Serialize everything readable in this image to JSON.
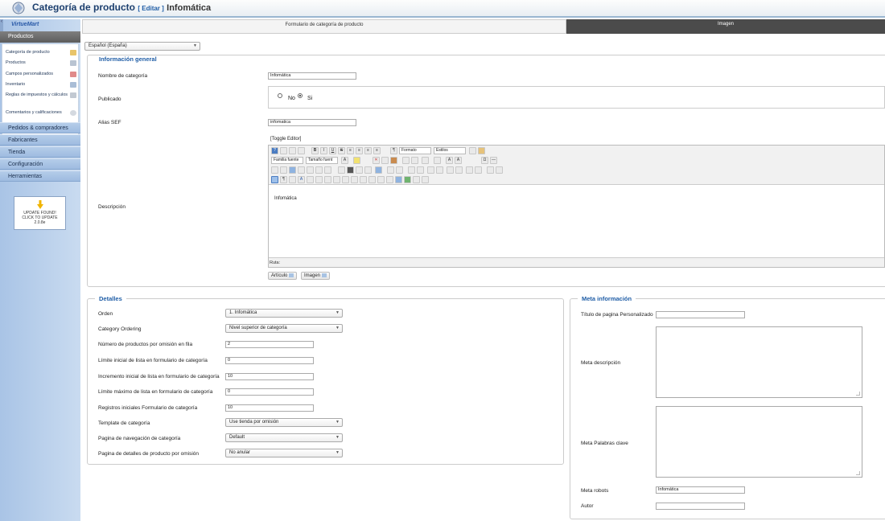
{
  "header": {
    "title": "Categoría de producto",
    "edit_label": "[ Editar ]",
    "item_name": "Infomática"
  },
  "sidebar": {
    "brand": "VirtueMart",
    "active_section": "Productos",
    "product_items": [
      "Categoría de producto",
      "Productos",
      "Campos personalizados",
      "Inventario",
      "Reglas de impuestos y cálculos",
      "Comentarios y calificaciones"
    ],
    "sections": [
      "Pedidos & compradores",
      "Fabricantes",
      "Tienda",
      "Configuración",
      "Herramientas"
    ],
    "update": {
      "line1": "UPDATE FOUND!",
      "line2": "CLICK TO UPDATE",
      "version": "2.0.8e"
    }
  },
  "tabs": {
    "form": "Formulario de categoría de producto",
    "image": "Imagen"
  },
  "language_select": "Español (España)",
  "general": {
    "legend": "Información general",
    "name_label": "Nombre de categoría",
    "name_value": "Infomática",
    "published_label": "Publicado",
    "published_no": "No",
    "published_yes": "Si",
    "published_value": "Si",
    "alias_label": "Alias SEF",
    "alias_value": "infomatica",
    "description_label": "Descripción",
    "toggle_editor": "[Toggle Editor]",
    "editor_format": "Formato",
    "editor_styles": "Estilos",
    "editor_font": "Familia fuente",
    "editor_size": "Tamaño fuent",
    "editor_content": "Infomática",
    "editor_path": "Ruta:",
    "btn_article": "Artículo",
    "btn_image": "Imagen"
  },
  "details": {
    "legend": "Detalles",
    "rows": [
      {
        "label": "Orden",
        "value": "1. Infomática"
      },
      {
        "label": "Category Ordering",
        "value": "Nivel superior de categoría"
      },
      {
        "label": "Número de productos por omisión en fila",
        "value": "2"
      },
      {
        "label": "Límite inicial de lista en formulario de categoría",
        "value": "0"
      },
      {
        "label": "Incremento inicial de lista en formulario de categoría",
        "value": "10"
      },
      {
        "label": "Límite máximo de lista en formulario de categoría",
        "value": "0"
      },
      {
        "label": "Registros iniciales Formulario de categoría",
        "value": "10"
      },
      {
        "label": "Template de categoría",
        "value": "Use tienda por omisión"
      },
      {
        "label": "Pagina de navegación de categoría",
        "value": "Default"
      },
      {
        "label": "Pagina de detalles de producto por omisión",
        "value": "No anular"
      }
    ]
  },
  "meta": {
    "legend": "Meta información",
    "title_label": "Título de pagina Personalizado",
    "title_value": "",
    "desc_label": "Meta descripción",
    "keywords_label": "Meta Palabras clave",
    "robots_label": "Meta robots",
    "robots_value": "Infomática",
    "author_label": "Autor",
    "author_value": ""
  },
  "colors": {
    "accent": "#1f5da6",
    "sidebar": "#a9c4e6",
    "tab_dark": "#4b4b4b"
  }
}
